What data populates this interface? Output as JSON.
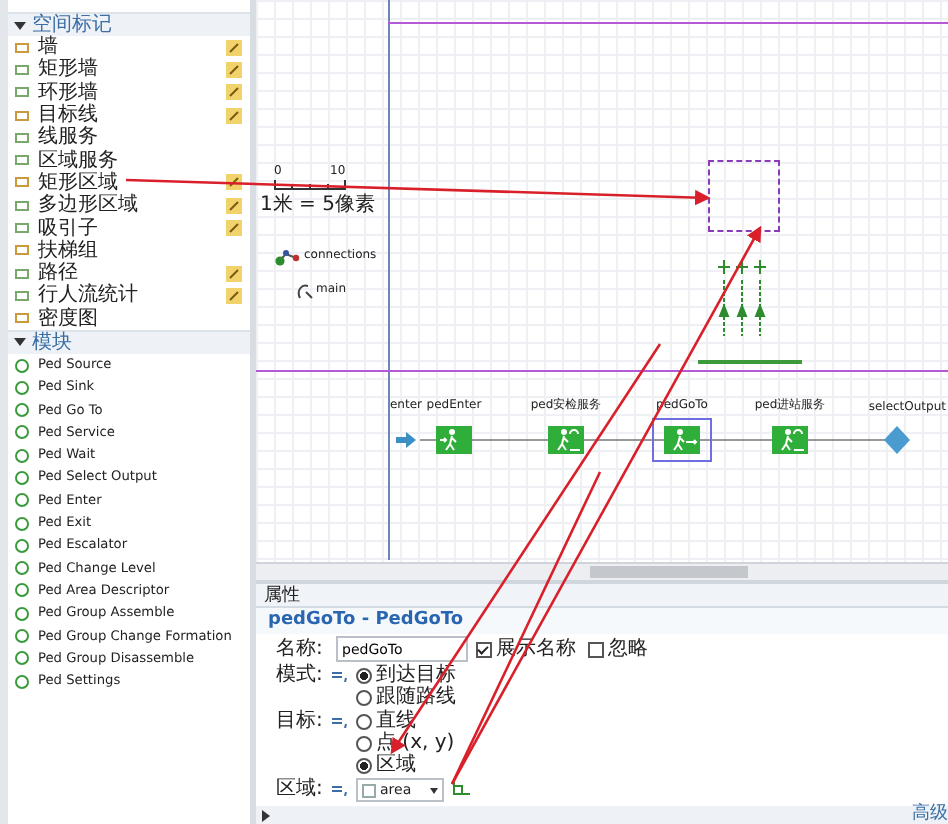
{
  "palette": {
    "sections": [
      {
        "title": "空间标记",
        "expanded": true,
        "kind": "space",
        "items": [
          {
            "label": "墙",
            "draw_mode": true
          },
          {
            "label": "矩形墙",
            "draw_mode": true
          },
          {
            "label": "环形墙",
            "draw_mode": true
          },
          {
            "label": "目标线",
            "draw_mode": true
          },
          {
            "label": "线服务",
            "draw_mode": false
          },
          {
            "label": "区域服务",
            "draw_mode": false
          },
          {
            "label": "矩形区域",
            "draw_mode": true
          },
          {
            "label": "多边形区域",
            "draw_mode": true
          },
          {
            "label": "吸引子",
            "draw_mode": true
          },
          {
            "label": "扶梯组",
            "draw_mode": false
          },
          {
            "label": "路径",
            "draw_mode": true
          },
          {
            "label": "行人流统计",
            "draw_mode": true
          },
          {
            "label": "密度图",
            "draw_mode": false
          }
        ]
      },
      {
        "title": "模块",
        "expanded": true,
        "kind": "blocks",
        "items": [
          {
            "label": "Ped Source",
            "draw_mode": false
          },
          {
            "label": "Ped Sink",
            "draw_mode": false
          },
          {
            "label": "Ped Go To",
            "draw_mode": false
          },
          {
            "label": "Ped Service",
            "draw_mode": false
          },
          {
            "label": "Ped Wait",
            "draw_mode": false
          },
          {
            "label": "Ped Select Output",
            "draw_mode": false
          },
          {
            "label": "Ped Enter",
            "draw_mode": false
          },
          {
            "label": "Ped Exit",
            "draw_mode": false
          },
          {
            "label": "Ped Escalator",
            "draw_mode": false
          },
          {
            "label": "Ped Change Level",
            "draw_mode": false
          },
          {
            "label": "Ped Area Descriptor",
            "draw_mode": false
          },
          {
            "label": "Ped Group Assemble",
            "draw_mode": false
          },
          {
            "label": "Ped Group Change Formation",
            "draw_mode": false
          },
          {
            "label": "Ped Group Disassemble",
            "draw_mode": false
          },
          {
            "label": "Ped Settings",
            "draw_mode": false
          }
        ]
      }
    ]
  },
  "canvas": {
    "scale": {
      "start": "0",
      "end": "10",
      "caption": "1米 = 5像素"
    },
    "objects": [
      {
        "kind": "connections",
        "label": "connections"
      },
      {
        "kind": "agent",
        "label": "main"
      }
    ],
    "flow": [
      {
        "kind": "source",
        "label": "enter",
        "selected": false
      },
      {
        "kind": "enter",
        "label": "pedEnter",
        "selected": false
      },
      {
        "kind": "service",
        "label": "ped安检服务",
        "selected": false
      },
      {
        "kind": "goto",
        "label": "pedGoTo",
        "selected": true
      },
      {
        "kind": "service",
        "label": "ped进站服务",
        "selected": false
      },
      {
        "kind": "select",
        "label": "selectOutput",
        "selected": false
      }
    ]
  },
  "properties": {
    "tab": "属性",
    "title": "pedGoTo - PedGoTo",
    "name_row": {
      "label": "名称:",
      "value": "pedGoTo",
      "checkboxes": [
        {
          "label": "展示名称",
          "checked": true
        },
        {
          "label": "忽略",
          "checked": false
        }
      ]
    },
    "rows": [
      {
        "kind": "radio",
        "label": "模式:",
        "options": [
          {
            "label": "到达目标",
            "selected": true
          },
          {
            "label": "跟随路线",
            "selected": false
          }
        ]
      },
      {
        "kind": "radio",
        "label": "目标:",
        "options": [
          {
            "label": "直线",
            "selected": false
          },
          {
            "label": "点 (x, y)",
            "selected": false
          },
          {
            "label": "区域",
            "selected": true
          }
        ]
      },
      {
        "kind": "dropdown",
        "label": "区域:",
        "value": "area"
      }
    ],
    "collapsed_section": {
      "title": "高级",
      "expanded": false
    }
  }
}
